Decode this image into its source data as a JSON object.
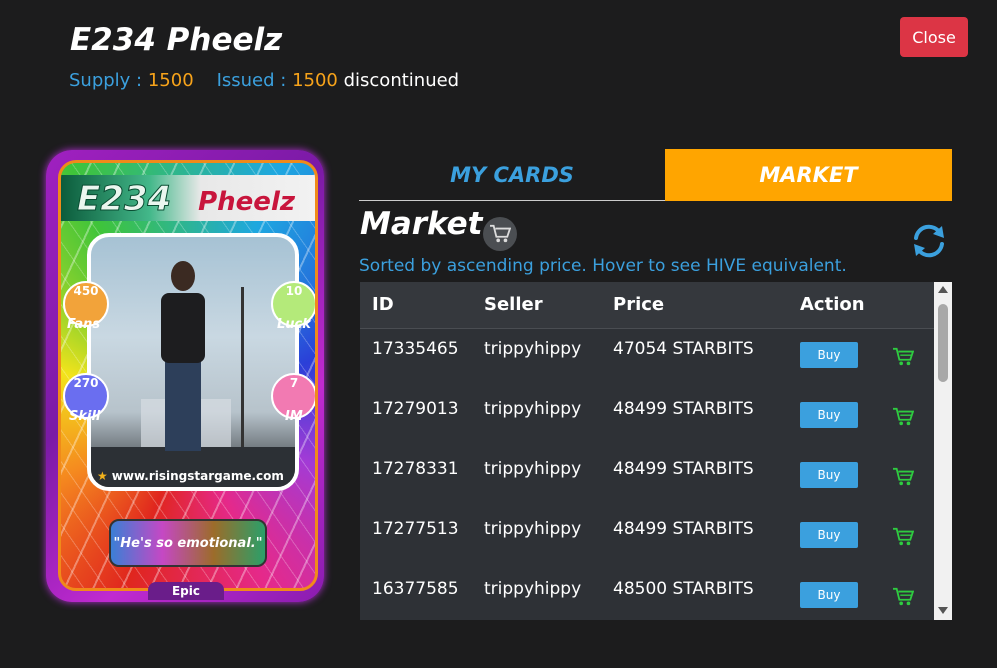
{
  "header": {
    "title": "E234 Pheelz",
    "supply_label": "Supply :",
    "supply_value": "1500",
    "issued_label": "Issued :",
    "issued_value": "1500",
    "status": "discontinued",
    "close_label": "Close"
  },
  "card": {
    "id": "E234",
    "name": "Pheelz",
    "stats": {
      "fans": {
        "value": "450",
        "label": "Fans"
      },
      "luck": {
        "value": "10",
        "label": "Luck"
      },
      "skill": {
        "value": "270",
        "label": "Skill"
      },
      "im": {
        "value": "7",
        "label": "IM"
      }
    },
    "website": "www.risingstargame.com",
    "quote": "\"He's so emotional.\"",
    "rarity": "Epic"
  },
  "tabs": [
    {
      "label": "MY CARDS",
      "active": false
    },
    {
      "label": "MARKET",
      "active": true
    }
  ],
  "market": {
    "title": "Market",
    "sorted_note": "Sorted by ascending price. Hover to see HIVE equivalent.",
    "columns": [
      "ID",
      "Seller",
      "Price",
      "Action"
    ],
    "rows": [
      {
        "id": "17335465",
        "seller": "trippyhippy",
        "price": "47054 STARBITS",
        "action": "Buy"
      },
      {
        "id": "17279013",
        "seller": "trippyhippy",
        "price": "48499 STARBITS",
        "action": "Buy"
      },
      {
        "id": "17278331",
        "seller": "trippyhippy",
        "price": "48499 STARBITS",
        "action": "Buy"
      },
      {
        "id": "17277513",
        "seller": "trippyhippy",
        "price": "48499 STARBITS",
        "action": "Buy"
      },
      {
        "id": "16377585",
        "seller": "trippyhippy",
        "price": "48500 STARBITS",
        "action": "Buy"
      }
    ]
  },
  "colors": {
    "accent_blue": "#3ba0de",
    "accent_orange": "#ffa500",
    "close_red": "#dc3545",
    "cart_green": "#2ecc40"
  },
  "icons": [
    "cart-icon",
    "refresh-icon",
    "add-to-cart-icon",
    "star-icon"
  ]
}
